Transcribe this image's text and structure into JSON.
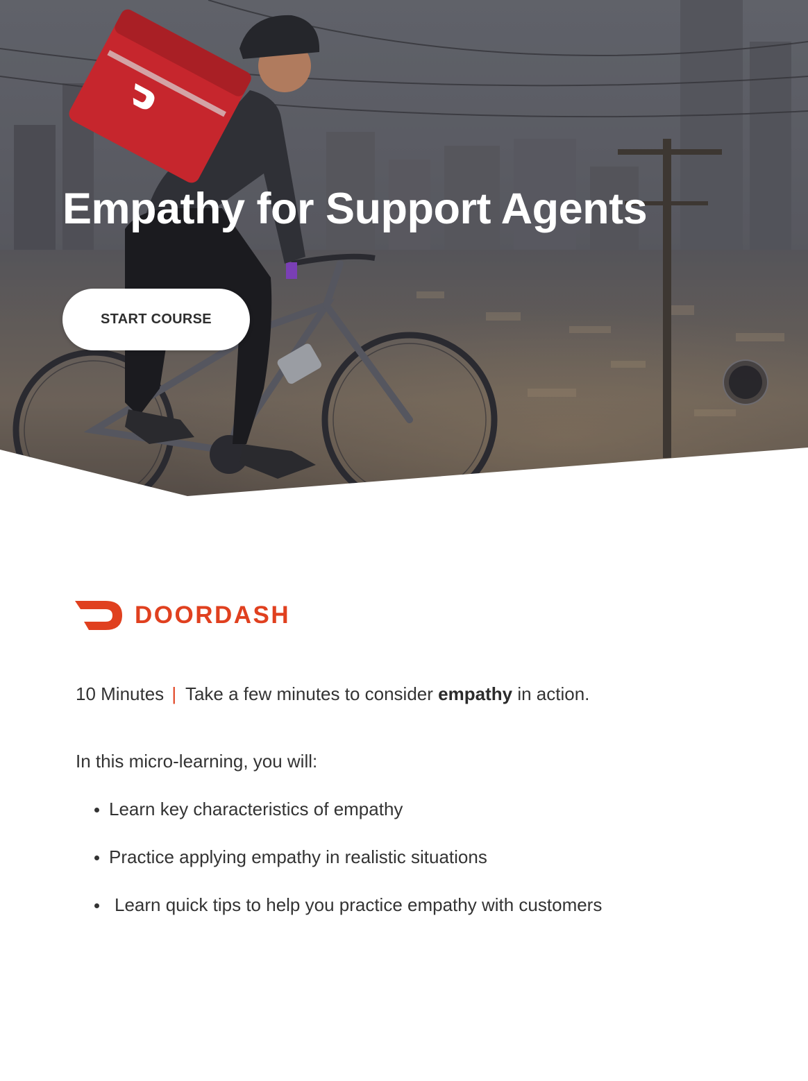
{
  "hero": {
    "title": "Empathy for Support Agents",
    "start_button_label": "START COURSE",
    "image_alt": "Delivery courier riding a bicycle with a red insulated bag in front of a city skyline"
  },
  "brand": {
    "logo_icon": "doordash-dash-icon",
    "name": "DOORDASH",
    "color": "#e0401f"
  },
  "meta": {
    "duration": "10 Minutes",
    "separator": "|",
    "description_before": "Take a few minutes to consider",
    "description_bold": "empathy",
    "description_after": "in action."
  },
  "intro": "In this micro-learning, you will:",
  "objectives": [
    "Learn key characteristics of empathy",
    "Practice applying empathy in realistic situations",
    "Learn quick tips to help you practice empathy with customers"
  ],
  "colors": {
    "accent": "#e0401f",
    "text": "#333333",
    "button_bg": "#ffffff"
  }
}
